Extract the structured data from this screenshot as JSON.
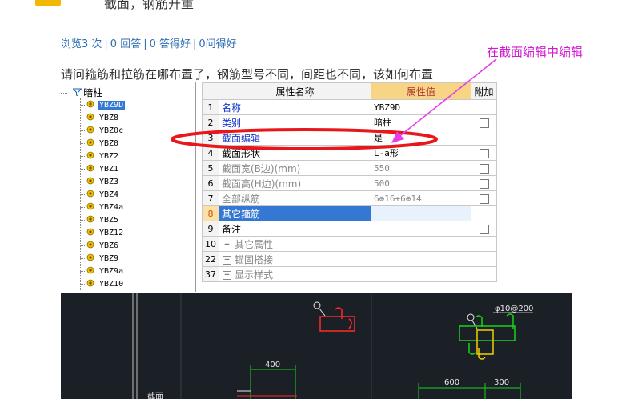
{
  "header": {
    "title": "截面，钢筋开重",
    "badge_color": "#f2b705"
  },
  "question": {
    "stats": {
      "views": "浏览3 次",
      "answers": "0 回答",
      "good": "0 答得好",
      "asked": "0问得好"
    },
    "text": "请问箍筋和拉筋在哪布置了，钢筋型号不同，间距也不同，该如何布置",
    "annotation": "在截面编辑中编辑",
    "annotation_color": "#d31ad3"
  },
  "tree": {
    "root": "暗柱",
    "items": [
      "YBZ9D",
      "YBZ8",
      "YBZ0c",
      "YBZ0",
      "YBZ2",
      "YBZ1",
      "YBZ3",
      "YBZ4",
      "YBZ4a",
      "YBZ5",
      "YBZ12",
      "YBZ6",
      "YBZ9",
      "YBZ9a",
      "YBZ10"
    ],
    "selected_index": 0
  },
  "properties": {
    "headers": {
      "no": "",
      "name": "属性名称",
      "value": "属性值",
      "add": "附加"
    },
    "rows": [
      {
        "no": "1",
        "name": "名称",
        "value": "YBZ9D",
        "style": "blue",
        "checkbox": false
      },
      {
        "no": "2",
        "name": "类别",
        "value": "暗柱",
        "style": "blue",
        "checkbox": true
      },
      {
        "no": "3",
        "name": "截面编辑",
        "value": "是",
        "style": "blue",
        "checkbox": false
      },
      {
        "no": "4",
        "name": "截面形状",
        "value": "L-a形",
        "style": "black",
        "checkbox": true
      },
      {
        "no": "5",
        "name": "截面宽(B边)(mm)",
        "value": "550",
        "style": "gray",
        "checkbox": true
      },
      {
        "no": "6",
        "name": "截面高(H边)(mm)",
        "value": "500",
        "style": "gray",
        "checkbox": true
      },
      {
        "no": "7",
        "name": "全部纵筋",
        "value": "6⊕16+6⊕14",
        "style": "gray",
        "checkbox": true
      },
      {
        "no": "8",
        "name": "其它箍筋",
        "value": "",
        "style": "selected",
        "checkbox": false
      },
      {
        "no": "9",
        "name": "备注",
        "value": "",
        "style": "black",
        "checkbox": true
      },
      {
        "no": "10",
        "name": "其它属性",
        "value": "",
        "style": "group",
        "checkbox": false
      },
      {
        "no": "22",
        "name": "锚固搭接",
        "value": "",
        "style": "group",
        "checkbox": false
      },
      {
        "no": "37",
        "name": "显示样式",
        "value": "",
        "style": "group",
        "checkbox": false
      }
    ]
  },
  "cad": {
    "labels": {
      "stirrup": "φ10@200",
      "dim_400": "400",
      "dim_600": "600",
      "dim_300": "300",
      "side_label": "截面"
    },
    "colors": {
      "bg": "#1b1f26",
      "green": "#18d418",
      "red": "#ff2b2b",
      "yellow": "#f0d000",
      "white": "#e8e8e8"
    }
  }
}
